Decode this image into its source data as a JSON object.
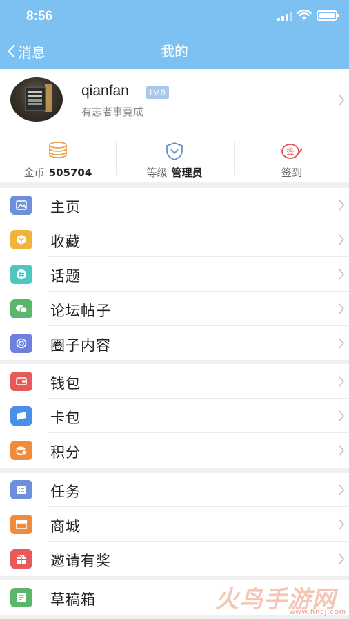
{
  "status_bar": {
    "time": "8:56"
  },
  "nav": {
    "back_label": "消息",
    "title": "我的"
  },
  "profile": {
    "username": "qianfan",
    "level": "LV.9",
    "motto": "有志者事竟成"
  },
  "stats": [
    {
      "label": "金币",
      "value": "505704",
      "icon": "coins-icon",
      "color": "#e9a24c"
    },
    {
      "label": "等级",
      "value": "管理员",
      "icon": "shield-icon",
      "color": "#6a8fcf"
    },
    {
      "label": "签到",
      "value": "",
      "icon": "sign-in-icon",
      "color": "#e0554e"
    }
  ],
  "menu_groups": [
    {
      "items": [
        {
          "label": "主页",
          "icon": "home-image-icon",
          "color": "#6f8fdc"
        },
        {
          "label": "收藏",
          "icon": "box-icon",
          "color": "#f0b43c"
        },
        {
          "label": "话题",
          "icon": "hashtag-icon",
          "color": "#4fc7c0"
        },
        {
          "label": "论坛帖子",
          "icon": "chat-icon",
          "color": "#5ab66a"
        },
        {
          "label": "圈子内容",
          "icon": "circle-icon",
          "color": "#6f7fe0"
        }
      ]
    },
    {
      "items": [
        {
          "label": "钱包",
          "icon": "wallet-icon",
          "color": "#e85a5a"
        },
        {
          "label": "卡包",
          "icon": "card-icon",
          "color": "#4a8fe8"
        },
        {
          "label": "积分",
          "icon": "points-icon",
          "color": "#f08a3c"
        }
      ]
    },
    {
      "items": [
        {
          "label": "任务",
          "icon": "task-icon",
          "color": "#6f8fdc"
        },
        {
          "label": "商城",
          "icon": "store-icon",
          "color": "#f08a3c"
        },
        {
          "label": "邀请有奖",
          "icon": "gift-icon",
          "color": "#e85a5a"
        }
      ]
    },
    {
      "items": [
        {
          "label": "草稿箱",
          "icon": "draft-icon",
          "color": "#5ab66a"
        }
      ]
    }
  ],
  "watermark": {
    "text": "火鸟手游网",
    "url": "www.hncj.com"
  }
}
